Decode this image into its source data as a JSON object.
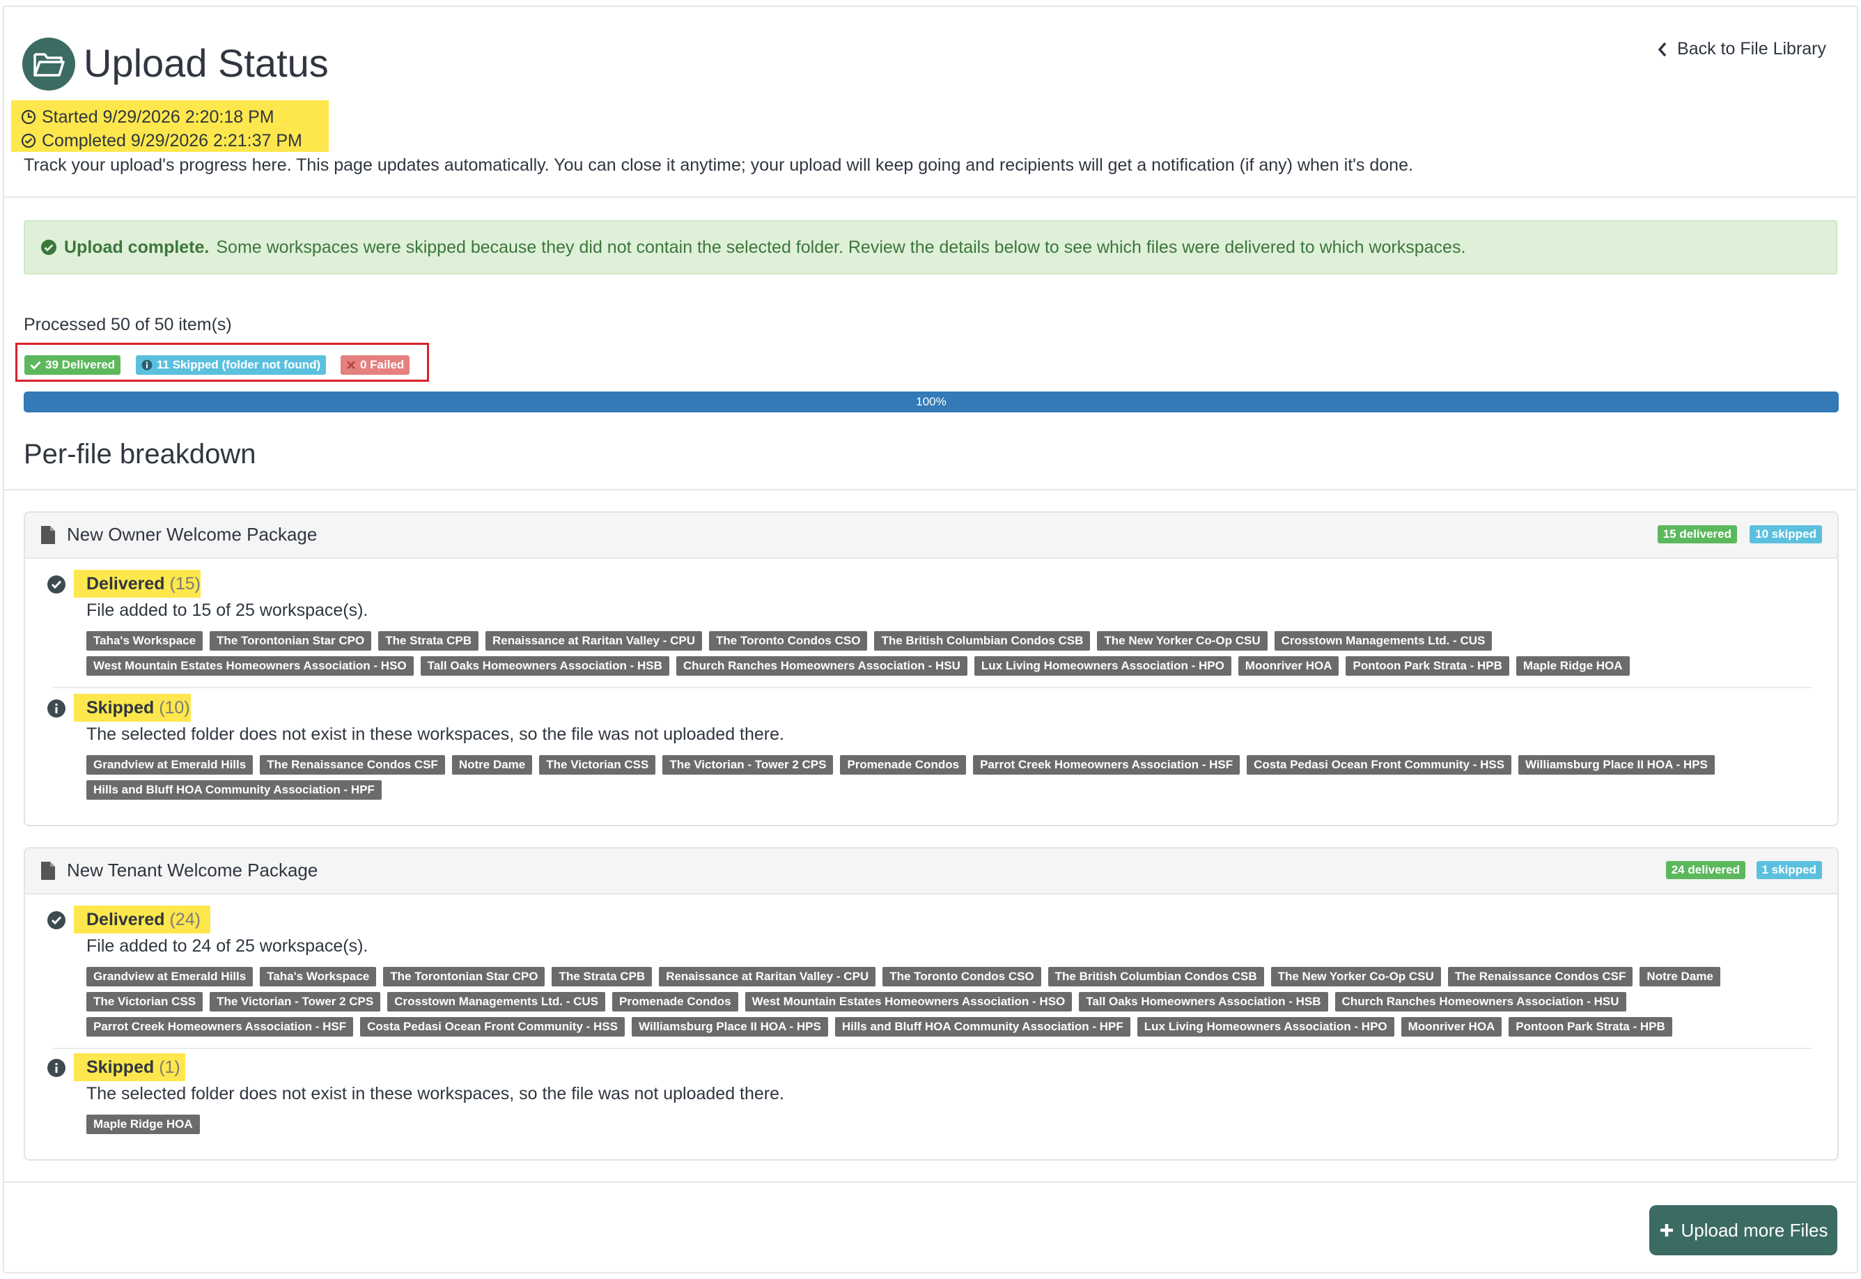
{
  "header": {
    "title": "Upload Status",
    "back_link": "Back to File Library",
    "started": "Started 9/29/2026 2:20:18 PM",
    "completed": "Completed 9/29/2026 2:21:37 PM",
    "track_text": "Track your upload's progress here. This page updates automatically. You can close it anytime; your upload will keep going and recipients will get a notification (if any) when it's done."
  },
  "alert": {
    "strong": "Upload complete.",
    "text": "Some workspaces were skipped because they did not contain the selected folder. Review the details below to see which files were delivered to which workspaces."
  },
  "summary": {
    "processed": "Processed 50 of 50 item(s)",
    "delivered": "39 Delivered",
    "skipped": "11 Skipped (folder not found)",
    "failed": "0 Failed",
    "progress_label": "100%",
    "progress_value": 1.0
  },
  "breakdown_title": "Per-file breakdown",
  "files": [
    {
      "name": "New Owner Welcome Package",
      "delivered_badge": "15 delivered",
      "skipped_badge": "10 skipped",
      "delivered_label": "Delivered",
      "delivered_count": "(15)",
      "delivered_desc": "File added to 15 of 25 workspace(s).",
      "delivered_workspaces": [
        "Taha's Workspace",
        "The Torontonian Star CPO",
        "The Strata CPB",
        "Renaissance at Raritan Valley - CPU",
        "The Toronto Condos CSO",
        "The British Columbian Condos CSB",
        "The New Yorker Co-Op CSU",
        "Crosstown Managements Ltd. - CUS",
        "West Mountain Estates Homeowners Association - HSO",
        "Tall Oaks Homeowners Association - HSB",
        "Church Ranches Homeowners Association - HSU",
        "Lux Living Homeowners Association - HPO",
        "Moonriver HOA",
        "Pontoon Park Strata - HPB",
        "Maple Ridge HOA"
      ],
      "skipped_label": "Skipped",
      "skipped_count": "(10)",
      "skipped_desc": "The selected folder does not exist in these workspaces, so the file was not uploaded there.",
      "skipped_workspaces": [
        "Grandview at Emerald Hills",
        "The Renaissance Condos CSF",
        "Notre Dame",
        "The Victorian CSS",
        "The Victorian - Tower 2 CPS",
        "Promenade Condos",
        "Parrot Creek Homeowners Association - HSF",
        "Costa Pedasi Ocean Front Community - HSS",
        "Williamsburg Place II HOA - HPS",
        "Hills and Bluff HOA Community Association - HPF"
      ]
    },
    {
      "name": "New Tenant Welcome Package",
      "delivered_badge": "24 delivered",
      "skipped_badge": "1 skipped",
      "delivered_label": "Delivered",
      "delivered_count": "(24)",
      "delivered_desc": "File added to 24 of 25 workspace(s).",
      "delivered_workspaces": [
        "Grandview at Emerald Hills",
        "Taha's Workspace",
        "The Torontonian Star CPO",
        "The Strata CPB",
        "Renaissance at Raritan Valley - CPU",
        "The Toronto Condos CSO",
        "The British Columbian Condos CSB",
        "The New Yorker Co-Op CSU",
        "The Renaissance Condos CSF",
        "Notre Dame",
        "The Victorian CSS",
        "The Victorian - Tower 2 CPS",
        "Crosstown Managements Ltd. - CUS",
        "Promenade Condos",
        "West Mountain Estates Homeowners Association - HSO",
        "Tall Oaks Homeowners Association - HSB",
        "Church Ranches Homeowners Association - HSU",
        "Parrot Creek Homeowners Association - HSF",
        "Costa Pedasi Ocean Front Community - HSS",
        "Williamsburg Place II HOA - HPS",
        "Hills and Bluff HOA Community Association - HPF",
        "Lux Living Homeowners Association - HPO",
        "Moonriver HOA",
        "Pontoon Park Strata - HPB"
      ],
      "skipped_label": "Skipped",
      "skipped_count": "(1)",
      "skipped_desc": "The selected folder does not exist in these workspaces, so the file was not uploaded there.",
      "skipped_workspaces": [
        "Maple Ridge HOA"
      ]
    }
  ],
  "footer": {
    "upload_more": "Upload more Files"
  },
  "colors": {
    "brand": "#3b6b63",
    "success": "#5cb85c",
    "info": "#5bc0de",
    "danger": "#e4807e",
    "progress": "#337ab7",
    "highlight": "#fde74c",
    "tag": "#6b6b6b"
  }
}
